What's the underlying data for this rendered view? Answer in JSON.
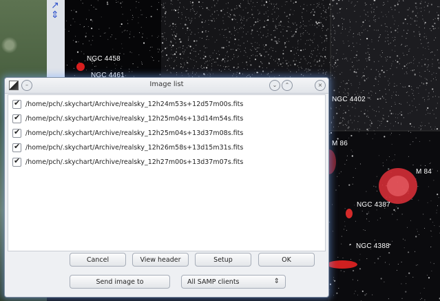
{
  "sky": {
    "labels": {
      "ngc4458": "NGC 4458",
      "ngc4461": "NGC 4461",
      "ngc4402": "NGC 4402",
      "m86": "M 86",
      "m84": "M 84",
      "ngc4387": "NGC 4387",
      "ngc4388": "NGC 4388"
    }
  },
  "dialog": {
    "title": "Image list",
    "files": [
      "/home/pch/.skychart/Archive/realsky_12h24m53s+12d57m00s.fits",
      "/home/pch/.skychart/Archive/realsky_12h25m04s+13d14m54s.fits",
      "/home/pch/.skychart/Archive/realsky_12h25m04s+13d37m08s.fits",
      "/home/pch/.skychart/Archive/realsky_12h26m58s+13d15m31s.fits",
      "/home/pch/.skychart/Archive/realsky_12h27m00s+13d37m07s.fits"
    ],
    "buttons": {
      "cancel": "Cancel",
      "view_header": "View header",
      "setup": "Setup",
      "ok": "OK",
      "send_image": "Send image to"
    },
    "send_target": "All SAMP clients"
  }
}
